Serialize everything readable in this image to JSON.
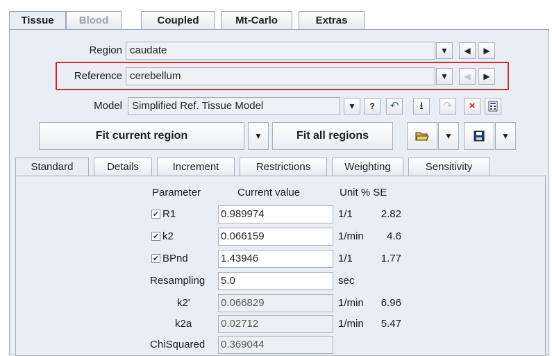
{
  "top_tabs": [
    "Tissue",
    "Blood",
    "Coupled",
    "Mt-Carlo",
    "Extras"
  ],
  "region": {
    "label": "Region",
    "value": "caudate"
  },
  "reference": {
    "label": "Reference",
    "value": "cerebellum"
  },
  "model": {
    "label": "Model",
    "value": "Simplified Ref. Tissue Model"
  },
  "buttons": {
    "fit_current": "Fit current region",
    "fit_all": "Fit all regions"
  },
  "icons": {
    "dropdown": "▼",
    "prev": "◀",
    "next": "▶",
    "help": "?",
    "undo": "↶",
    "download": "⭳",
    "redo": "↷",
    "close": "×"
  },
  "sub_tabs": [
    "Standard",
    "Details",
    "Increment",
    "Restrictions",
    "Weighting",
    "Sensitivity"
  ],
  "table": {
    "headers": {
      "parameter": "Parameter",
      "current_value": "Current value",
      "unit_se": "Unit % SE"
    },
    "rows": [
      {
        "name": "R1",
        "checked": true,
        "value": "0.989974",
        "unit": "1/1",
        "se": "2.82"
      },
      {
        "name": "k2",
        "checked": true,
        "value": "0.066159",
        "unit": "1/min",
        "se": "4.6"
      },
      {
        "name": "BPnd",
        "checked": true,
        "value": "1.43946",
        "unit": "1/1",
        "se": "1.77"
      },
      {
        "name": "Resampling",
        "value": "5.0",
        "unit": "sec",
        "se": ""
      },
      {
        "name": "k2'",
        "value": "0.066829",
        "unit": "1/min",
        "se": "6.96"
      },
      {
        "name": "k2a",
        "value": "0.02712",
        "unit": "1/min",
        "se": "5.47"
      },
      {
        "name": "ChiSquared",
        "value": "0.369044",
        "unit": "",
        "se": ""
      }
    ]
  }
}
